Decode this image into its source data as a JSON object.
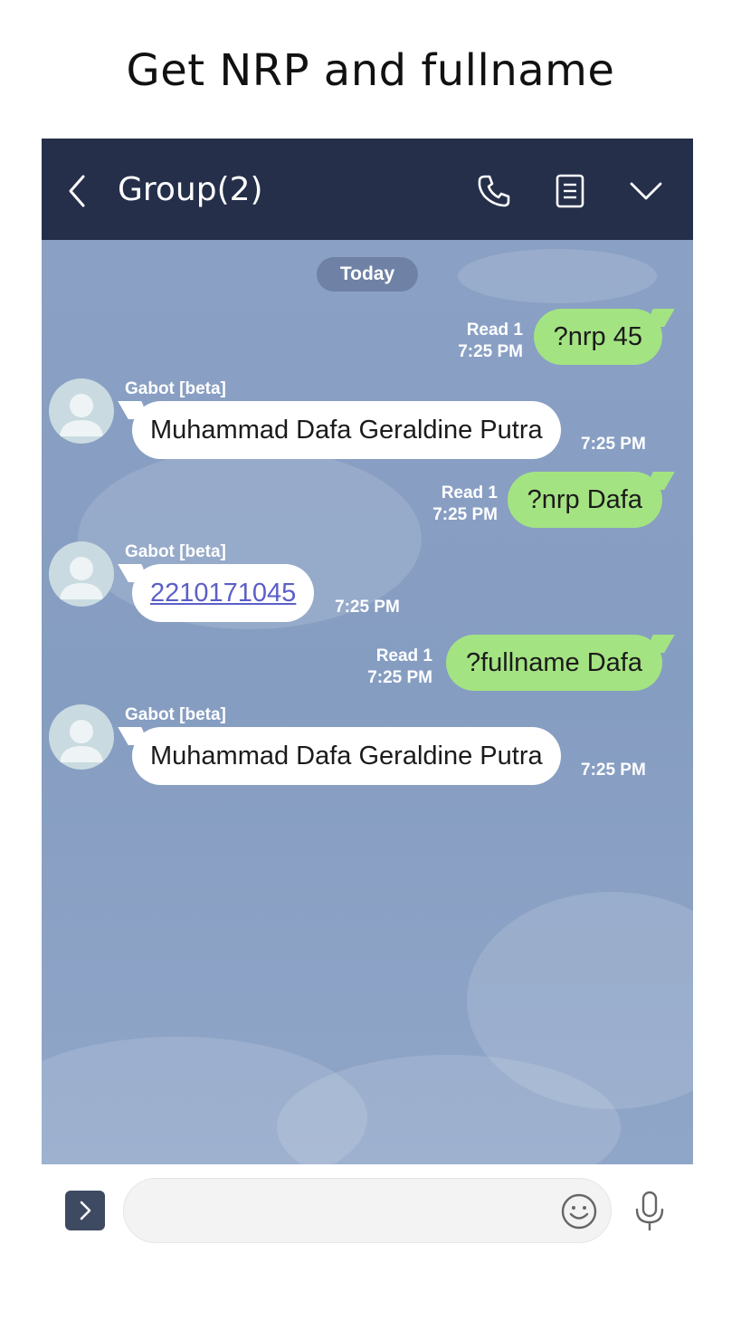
{
  "page_title": "Get NRP and fullname",
  "header": {
    "title": "Group(2)",
    "icons": [
      "back-arrow-icon",
      "phone-icon",
      "notes-icon",
      "chevron-down-icon"
    ]
  },
  "chat": {
    "date_label": "Today",
    "messages": [
      {
        "direction": "out",
        "text": "?nrp 45",
        "read": "Read 1",
        "time": "7:25 PM"
      },
      {
        "direction": "in",
        "sender": "Gabot [beta]",
        "text": "Muhammad Dafa Geraldine Putra",
        "time": "7:25 PM"
      },
      {
        "direction": "out",
        "text": "?nrp Dafa",
        "read": "Read 1",
        "time": "7:25 PM"
      },
      {
        "direction": "in",
        "sender": "Gabot [beta]",
        "text": "2210171045",
        "time": "7:25 PM",
        "is_link": true
      },
      {
        "direction": "out",
        "text": "?fullname Dafa",
        "read": "Read 1",
        "time": "7:25 PM"
      },
      {
        "direction": "in",
        "sender": "Gabot [beta]",
        "text": "Muhammad Dafa Geraldine Putra",
        "time": "7:25 PM"
      }
    ]
  },
  "input_bar": {
    "message_value": "",
    "icons": [
      "expand-icon",
      "emoji-icon",
      "microphone-icon"
    ]
  },
  "colors": {
    "header_bg": "#252f4a",
    "chat_bg": "#869dc2",
    "outgoing_bubble": "#a4e382",
    "incoming_bubble": "#ffffff",
    "link": "#5b5fc7"
  }
}
